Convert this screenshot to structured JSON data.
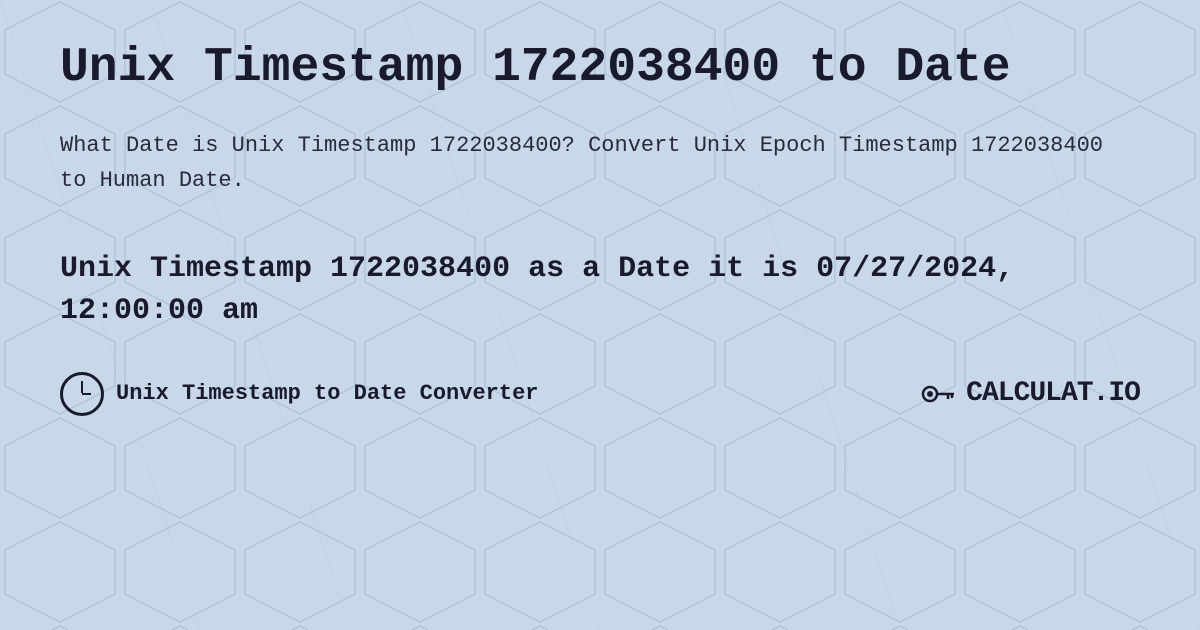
{
  "background": {
    "color": "#c8d8e8"
  },
  "header": {
    "title": "Unix Timestamp 1722038400 to Date"
  },
  "description": {
    "text": "What Date is Unix Timestamp 1722038400? Convert Unix Epoch Timestamp 1722038400 to Human Date."
  },
  "result": {
    "text": "Unix Timestamp 1722038400 as a Date it is 07/27/2024, 12:00:00 am"
  },
  "footer": {
    "label": "Unix Timestamp to Date Converter",
    "logo_text": "CALCULAT.IO"
  }
}
